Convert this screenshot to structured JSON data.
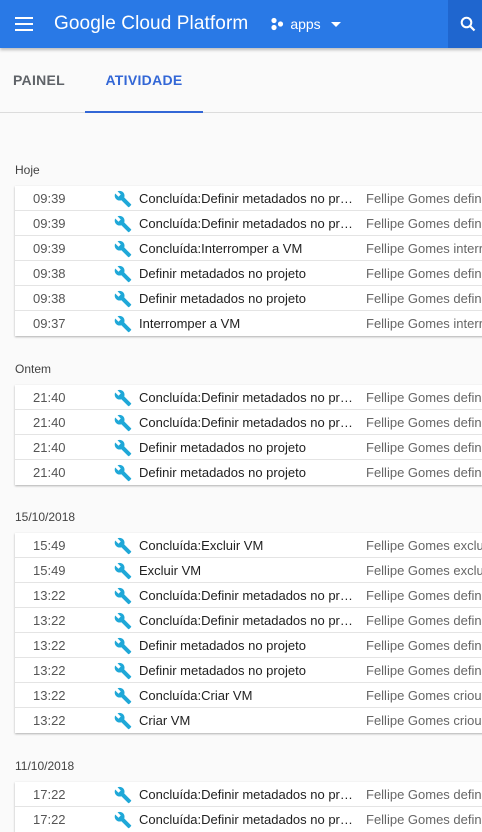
{
  "header": {
    "title": "Google Cloud Platform",
    "project": "apps",
    "icons": [
      "menu-icon",
      "project-icon",
      "caret-down-icon",
      "search-icon"
    ]
  },
  "tabs": [
    {
      "label": "PAINEL",
      "active": false
    },
    {
      "label": "ATIVIDADE",
      "active": true
    }
  ],
  "colors": {
    "header": "#2979e6",
    "accent": "#3367d6",
    "wrench": "#1fa8d8"
  },
  "groups": [
    {
      "label": "Hoje",
      "rows": [
        {
          "time": "09:39",
          "action": "Concluída:Definir metadados no projeto",
          "desc": "Fellipe Gomes definiu"
        },
        {
          "time": "09:39",
          "action": "Concluída:Definir metadados no projeto",
          "desc": "Fellipe Gomes definiu"
        },
        {
          "time": "09:39",
          "action": "Concluída:Interromper a VM",
          "desc": "Fellipe Gomes interrompeu"
        },
        {
          "time": "09:38",
          "action": "Definir metadados no projeto",
          "desc": "Fellipe Gomes definiu"
        },
        {
          "time": "09:38",
          "action": "Definir metadados no projeto",
          "desc": "Fellipe Gomes definiu"
        },
        {
          "time": "09:37",
          "action": "Interromper a VM",
          "desc": "Fellipe Gomes interrompeu"
        }
      ]
    },
    {
      "label": "Ontem",
      "rows": [
        {
          "time": "21:40",
          "action": "Concluída:Definir metadados no projeto",
          "desc": "Fellipe Gomes definiu"
        },
        {
          "time": "21:40",
          "action": "Concluída:Definir metadados no projeto",
          "desc": "Fellipe Gomes definiu"
        },
        {
          "time": "21:40",
          "action": "Definir metadados no projeto",
          "desc": "Fellipe Gomes definiu"
        },
        {
          "time": "21:40",
          "action": "Definir metadados no projeto",
          "desc": "Fellipe Gomes definiu"
        }
      ]
    },
    {
      "label": "15/10/2018",
      "rows": [
        {
          "time": "15:49",
          "action": "Concluída:Excluir VM",
          "desc": "Fellipe Gomes excluiu"
        },
        {
          "time": "15:49",
          "action": "Excluir VM",
          "desc": "Fellipe Gomes excluiu"
        },
        {
          "time": "13:22",
          "action": "Concluída:Definir metadados no projeto",
          "desc": "Fellipe Gomes definiu"
        },
        {
          "time": "13:22",
          "action": "Concluída:Definir metadados no projeto",
          "desc": "Fellipe Gomes definiu"
        },
        {
          "time": "13:22",
          "action": "Definir metadados no projeto",
          "desc": "Fellipe Gomes definiu"
        },
        {
          "time": "13:22",
          "action": "Definir metadados no projeto",
          "desc": "Fellipe Gomes definiu"
        },
        {
          "time": "13:22",
          "action": "Concluída:Criar VM",
          "desc": "Fellipe Gomes criou"
        },
        {
          "time": "13:22",
          "action": "Criar VM",
          "desc": "Fellipe Gomes criou"
        }
      ]
    },
    {
      "label": "11/10/2018",
      "rows": [
        {
          "time": "17:22",
          "action": "Concluída:Definir metadados no projeto",
          "desc": "Fellipe Gomes definiu"
        },
        {
          "time": "17:22",
          "action": "Concluída:Definir metadados no projeto",
          "desc": "Fellipe Gomes definiu"
        }
      ]
    }
  ]
}
